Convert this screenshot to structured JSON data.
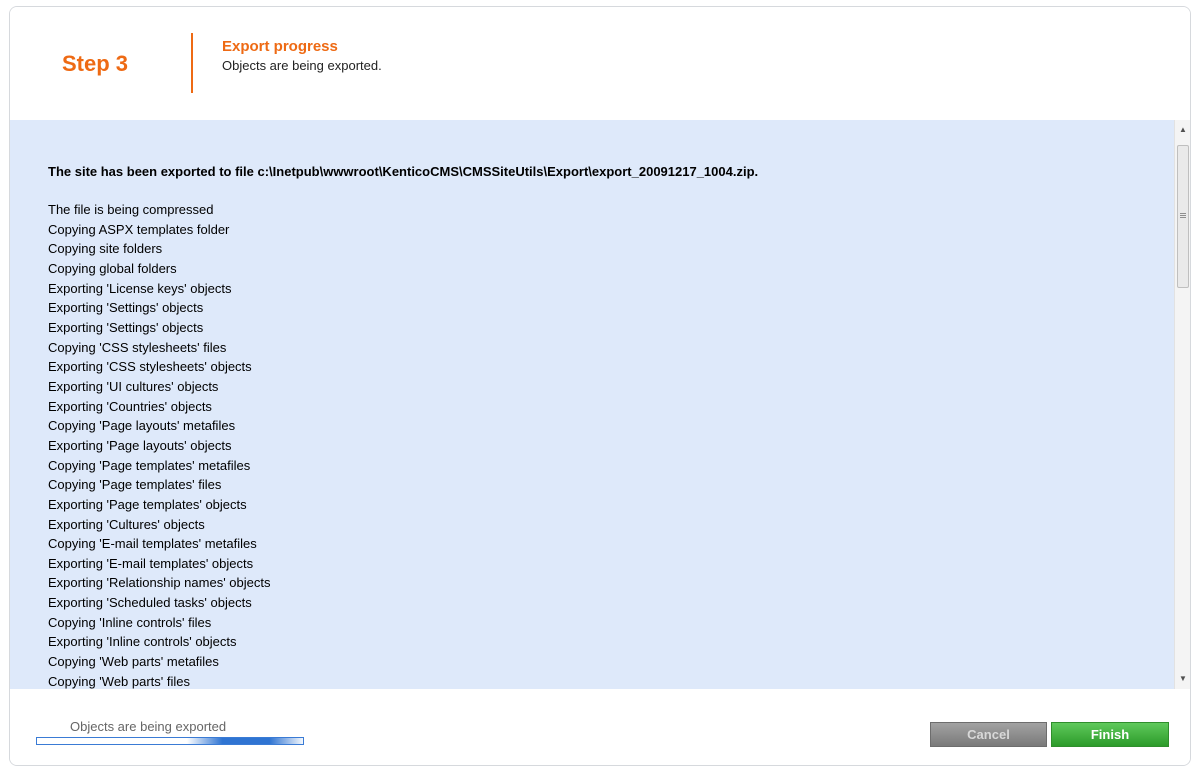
{
  "header": {
    "step_label": "Step 3",
    "title": "Export progress",
    "subtitle": "Objects are being exported."
  },
  "log": {
    "heading": "The site has been exported to file c:\\Inetpub\\wwwroot\\KenticoCMS\\CMSSiteUtils\\Export\\export_20091217_1004.zip.",
    "lines": [
      "The file is being compressed",
      "Copying ASPX templates folder",
      "Copying site folders",
      "Copying global folders",
      "Exporting 'License keys' objects",
      "Exporting 'Settings' objects",
      "Exporting 'Settings' objects",
      "Copying 'CSS stylesheets' files",
      "Exporting 'CSS stylesheets' objects",
      "Exporting 'UI cultures' objects",
      "Exporting 'Countries' objects",
      "Copying 'Page layouts' metafiles",
      "Exporting 'Page layouts' objects",
      "Copying 'Page templates' metafiles",
      "Copying 'Page templates' files",
      "Exporting 'Page templates' objects",
      "Exporting 'Cultures' objects",
      "Copying 'E-mail templates' metafiles",
      "Exporting 'E-mail templates' objects",
      "Exporting 'Relationship names' objects",
      "Exporting 'Scheduled tasks' objects",
      "Copying 'Inline controls' files",
      "Exporting 'Inline controls' objects",
      "Copying 'Web parts' metafiles",
      "Copying 'Web parts' files"
    ]
  },
  "footer": {
    "progress_label": "Objects are being exported",
    "cancel_label": "Cancel",
    "finish_label": "Finish"
  },
  "colors": {
    "accent": "#ee6a14",
    "log_background": "#dee9fa",
    "finish_button": "#3cb13a",
    "cancel_button": "#8c8c8c"
  },
  "icons": {
    "scroll_up": "arrow-up-icon",
    "scroll_down": "arrow-down-icon"
  }
}
